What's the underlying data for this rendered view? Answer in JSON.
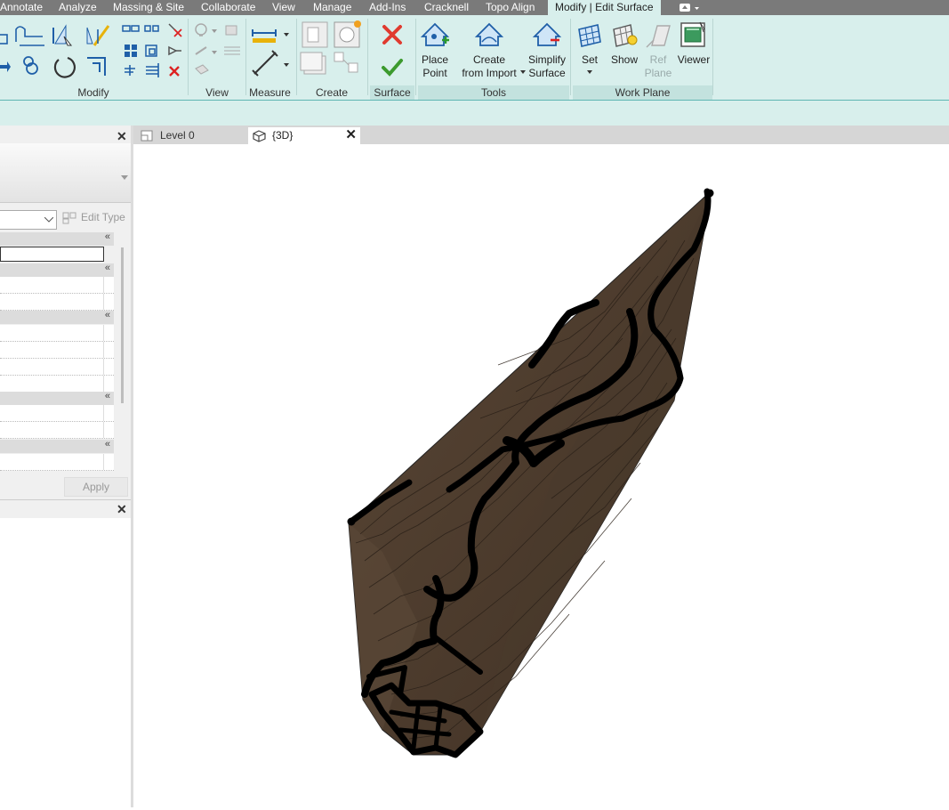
{
  "ribbon_tabs": [
    {
      "label": "Annotate"
    },
    {
      "label": "Analyze"
    },
    {
      "label": "Massing & Site"
    },
    {
      "label": "Collaborate"
    },
    {
      "label": "View"
    },
    {
      "label": "Manage"
    },
    {
      "label": "Add-Ins"
    },
    {
      "label": "Cracknell"
    },
    {
      "label": "Topo Align"
    },
    {
      "label": "Modify | Edit Surface",
      "active": true
    }
  ],
  "panels": {
    "modify": "Modify",
    "view": "View",
    "measure": "Measure",
    "create": "Create",
    "surface": "Surface",
    "tools": "Tools",
    "work_plane": "Work Plane"
  },
  "tools": {
    "place_point": "Place\nPoint",
    "create_from_import": "Create\nfrom Import",
    "simplify_surface": "Simplify\nSurface"
  },
  "work_plane": {
    "set": "Set",
    "show": "Show",
    "ref_plane": "Ref\nPlane",
    "viewer": "Viewer"
  },
  "properties": {
    "edit_type": "Edit Type",
    "apply": "Apply"
  },
  "view_tabs": [
    {
      "label": "Level 0"
    },
    {
      "label": "{3D}",
      "active": true
    }
  ],
  "colors": {
    "ribbon_bg": "#d8efec",
    "tabbar_bg": "#7a7a7a",
    "surface_fill": "#4b3a2c",
    "cancel": "#e03a2f",
    "finish": "#3c9a2e"
  }
}
